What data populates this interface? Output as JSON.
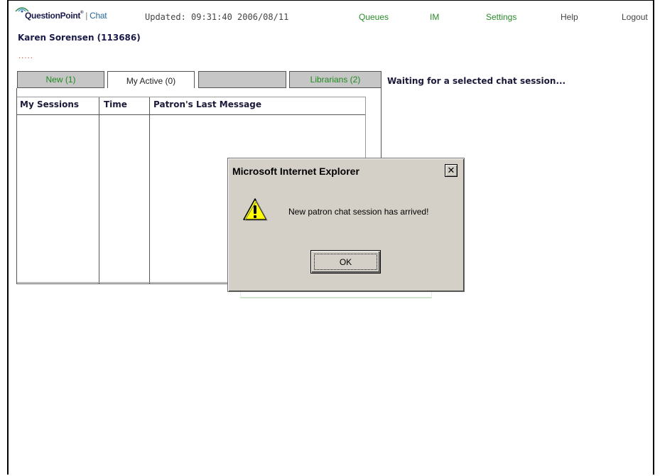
{
  "header": {
    "logo_name": "QuestionPoint",
    "logo_tm": "®",
    "logo_separator": "|",
    "logo_product": "Chat",
    "updated": "Updated: 09:31:40 2006/08/11"
  },
  "nav": {
    "queues": "Queues",
    "im": "IM",
    "settings": "Settings",
    "help": "Help",
    "logout": "Logout"
  },
  "user": {
    "name": "Karen Sorensen (113686)",
    "dots": "....."
  },
  "tabs": {
    "new": "New (1)",
    "my_active": "My Active (0)",
    "blank": "",
    "librarians": "Librarians (2)"
  },
  "status": {
    "waiting": "Waiting for a selected chat session..."
  },
  "table": {
    "headers": [
      "My Sessions",
      "Time",
      "Patron's Last Message"
    ]
  },
  "dialog": {
    "title": "Microsoft Internet Explorer",
    "close_glyph": "✕",
    "message": "New patron chat session has arrived!",
    "ok_label": "OK",
    "icon": "warning-icon"
  },
  "colors": {
    "nav_green": "#2a8a2a",
    "tab_green": "#1f8a1f",
    "dialog_gray": "#d4d0c8",
    "dots_red": "#d23a1e"
  }
}
